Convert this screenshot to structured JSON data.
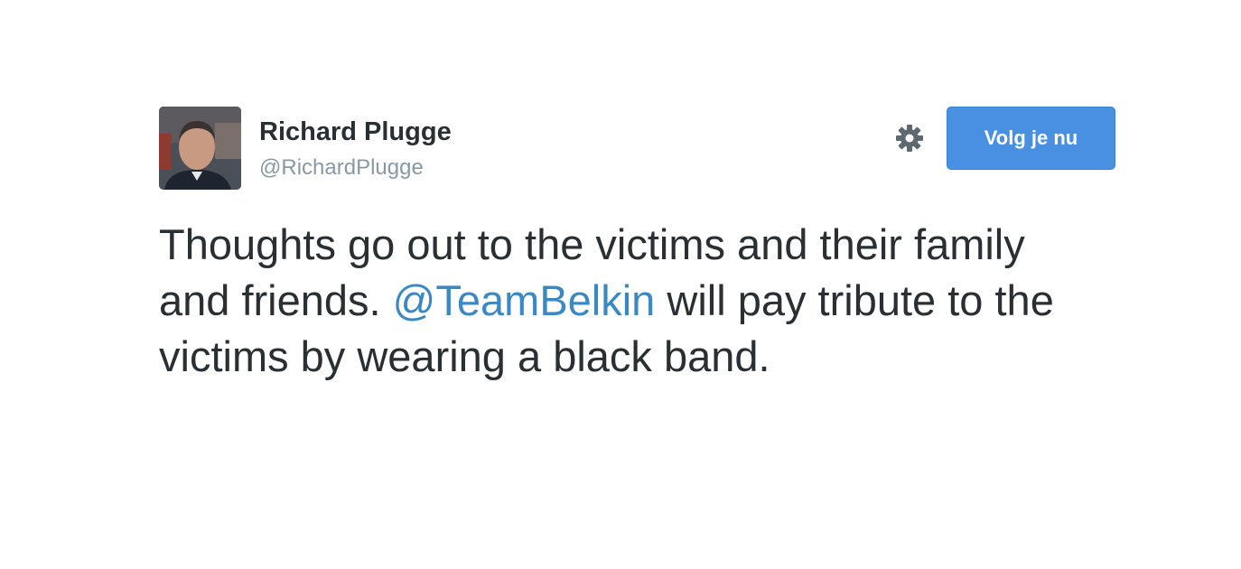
{
  "tweet": {
    "author_name": "Richard Plugge",
    "author_handle": "@RichardPlugge",
    "follow_label": "Volg je nu",
    "settings_icon": "gear-icon",
    "text_before": "Thoughts go out to the victims and their family and friends.",
    "mention": "@TeamBelkin",
    "text_after": "will pay tribute to the victims by wearing a black band."
  },
  "colors": {
    "follow_button": "#4a90e2",
    "mention": "#3b88c3",
    "text": "#292f33",
    "handle": "#8899a6"
  }
}
